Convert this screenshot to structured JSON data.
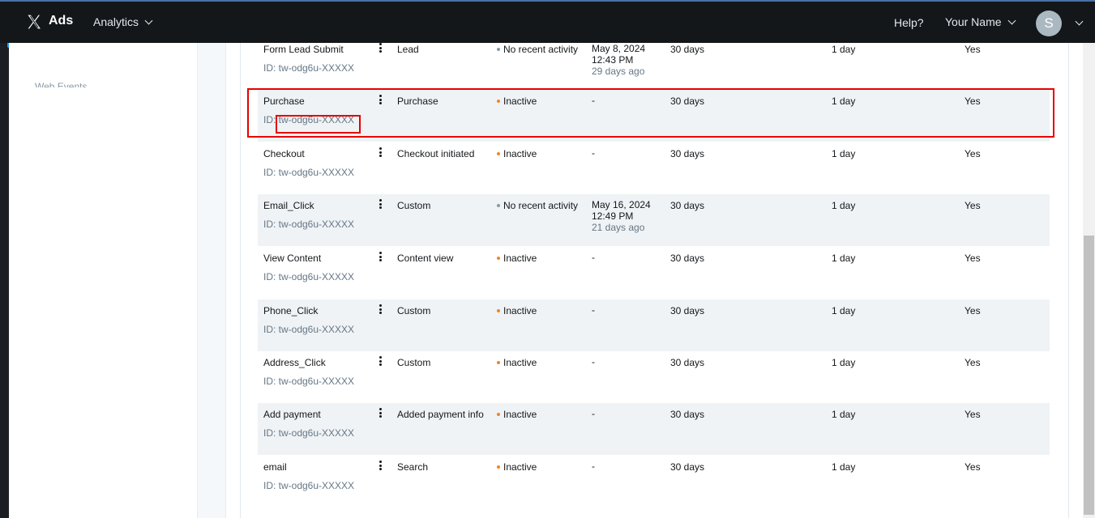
{
  "header": {
    "brand": "Ads",
    "nav_analytics": "Analytics",
    "help": "Help?",
    "username": "Your Name",
    "avatar_initial": "S"
  },
  "sidebar": {
    "ghost_text": "Web Events"
  },
  "colors": {
    "inactive": "#f58220",
    "no_recent": "#8899a6",
    "highlight": "#e60000"
  },
  "events": [
    {
      "name": "Form Lead Submit",
      "id": "ID: tw-odg6u-XXXXX",
      "category": "Lead",
      "status": "No recent activity",
      "status_kind": "no_recent",
      "last_date": "May 8, 2024",
      "last_time": "12:43 PM",
      "last_ago": "29 days ago",
      "post_engagement": "30 days",
      "view_through": "1 day",
      "active": "Yes"
    },
    {
      "name": "Purchase",
      "id": "ID: tw-odg6u-XXXXX",
      "category": "Purchase",
      "status": "Inactive",
      "status_kind": "inactive",
      "last_date": "-",
      "last_time": "",
      "last_ago": "",
      "post_engagement": "30 days",
      "view_through": "1 day",
      "active": "Yes"
    },
    {
      "name": "Checkout",
      "id": "ID: tw-odg6u-XXXXX",
      "category": "Checkout initiated",
      "status": "Inactive",
      "status_kind": "inactive",
      "last_date": "-",
      "last_time": "",
      "last_ago": "",
      "post_engagement": "30 days",
      "view_through": "1 day",
      "active": "Yes"
    },
    {
      "name": "Email_Click",
      "id": "ID: tw-odg6u-XXXXX",
      "category": "Custom",
      "status": "No recent activity",
      "status_kind": "no_recent",
      "last_date": "May 16, 2024",
      "last_time": "12:49 PM",
      "last_ago": "21 days ago",
      "post_engagement": "30 days",
      "view_through": "1 day",
      "active": "Yes"
    },
    {
      "name": "View Content",
      "id": "ID: tw-odg6u-XXXXX",
      "category": "Content view",
      "status": "Inactive",
      "status_kind": "inactive",
      "last_date": "-",
      "last_time": "",
      "last_ago": "",
      "post_engagement": "30 days",
      "view_through": "1 day",
      "active": "Yes"
    },
    {
      "name": "Phone_Click",
      "id": "ID: tw-odg6u-XXXXX",
      "category": "Custom",
      "status": "Inactive",
      "status_kind": "inactive",
      "last_date": "-",
      "last_time": "",
      "last_ago": "",
      "post_engagement": "30 days",
      "view_through": "1 day",
      "active": "Yes"
    },
    {
      "name": "Address_Click",
      "id": "ID: tw-odg6u-XXXXX",
      "category": "Custom",
      "status": "Inactive",
      "status_kind": "inactive",
      "last_date": "-",
      "last_time": "",
      "last_ago": "",
      "post_engagement": "30 days",
      "view_through": "1 day",
      "active": "Yes"
    },
    {
      "name": "Add payment",
      "id": "ID: tw-odg6u-XXXXX",
      "category": "Added payment info",
      "status": "Inactive",
      "status_kind": "inactive",
      "last_date": "-",
      "last_time": "",
      "last_ago": "",
      "post_engagement": "30 days",
      "view_through": "1 day",
      "active": "Yes"
    },
    {
      "name": "email",
      "id": "ID: tw-odg6u-XXXXX",
      "category": "Search",
      "status": "Inactive",
      "status_kind": "inactive",
      "last_date": "-",
      "last_time": "",
      "last_ago": "",
      "post_engagement": "30 days",
      "view_through": "1 day",
      "active": "Yes"
    }
  ]
}
